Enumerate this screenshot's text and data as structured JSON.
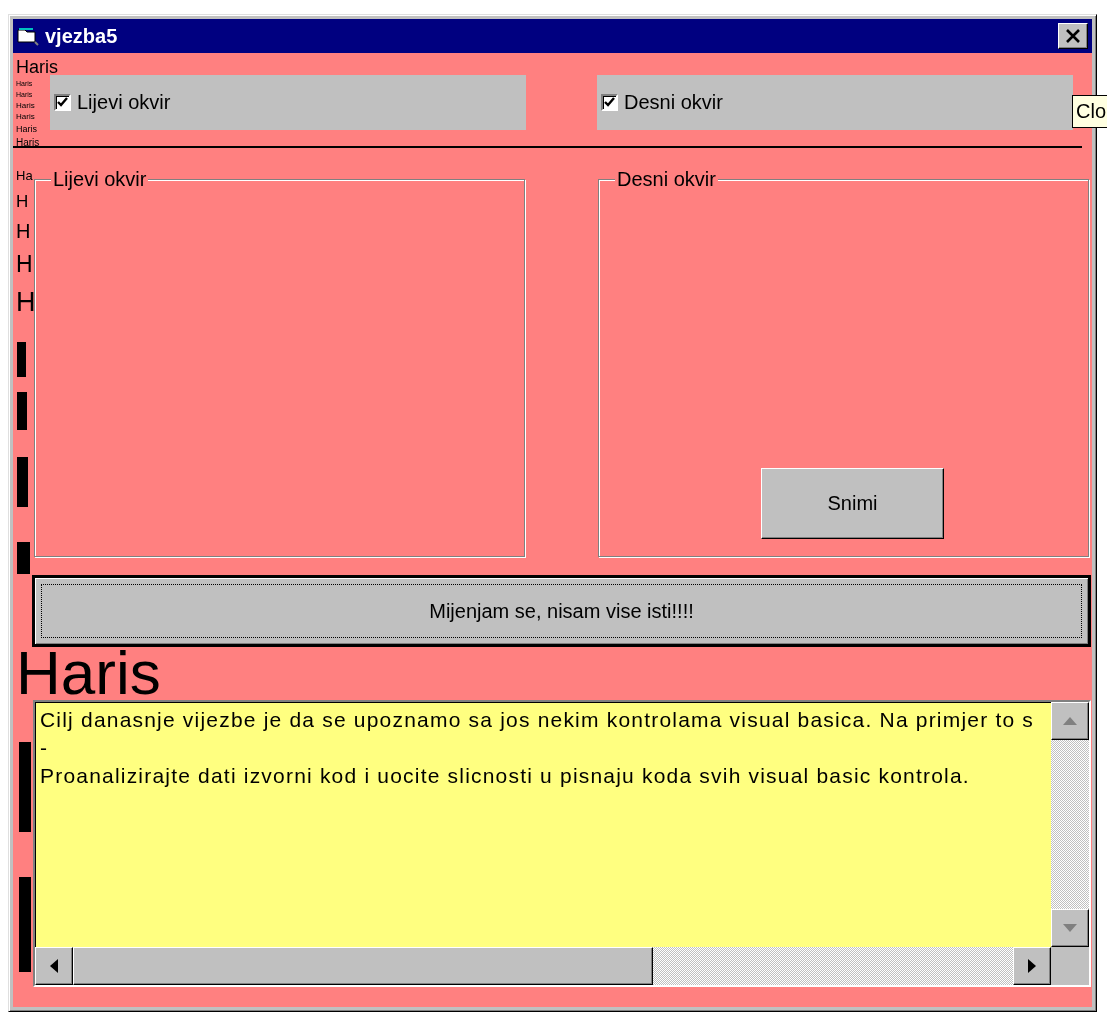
{
  "window": {
    "title": "vjezba5"
  },
  "tooltip": {
    "text": "Clo"
  },
  "background_prints": [
    "Haris",
    "Haris",
    "Haris",
    "Haris",
    "Haris",
    "Haris",
    "Haris",
    "Ha",
    "H",
    "H",
    "H",
    "H",
    "Haris"
  ],
  "checkboxes": [
    {
      "label": "Lijevi okvir",
      "checked": true
    },
    {
      "label": "Desni okvir",
      "checked": true
    }
  ],
  "frames": [
    {
      "legend": "Lijevi okvir"
    },
    {
      "legend": "Desni okvir"
    }
  ],
  "save_button": {
    "label": "Snimi"
  },
  "wide_button": {
    "label": "Mijenjam se, nisam vise isti!!!!",
    "focused": true
  },
  "text_box": {
    "lines": [
      "Cilj danasnje vijezbe je da se upoznamo sa jos nekim kontrolama visual basica. Na primjer to s",
      "-",
      "Proanalizirajte dati izvorni kod i uocite slicnosti u pisnaju koda svih visual basic kontrola."
    ]
  }
}
